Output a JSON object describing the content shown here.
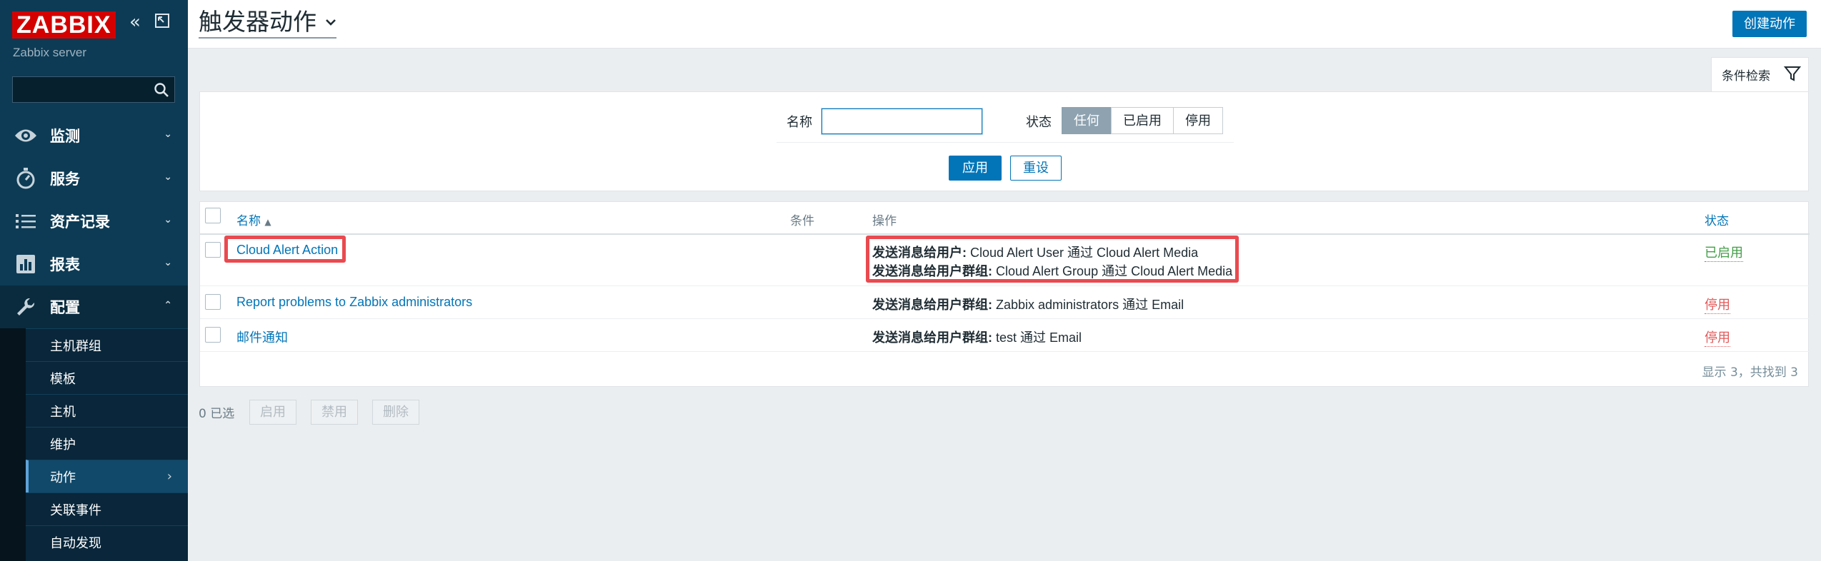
{
  "sidebar": {
    "logo": "ZABBIX",
    "server_name": "Zabbix server",
    "search_placeholder": "",
    "menu": [
      {
        "label": "监测",
        "icon": "eye-icon"
      },
      {
        "label": "服务",
        "icon": "stopwatch-icon"
      },
      {
        "label": "资产记录",
        "icon": "list-icon"
      },
      {
        "label": "报表",
        "icon": "report-chart-icon"
      },
      {
        "label": "配置",
        "icon": "wrench-icon"
      }
    ],
    "submenu": [
      {
        "label": "主机群组"
      },
      {
        "label": "模板"
      },
      {
        "label": "主机"
      },
      {
        "label": "维护"
      },
      {
        "label": "动作"
      },
      {
        "label": "关联事件"
      },
      {
        "label": "自动发现"
      }
    ]
  },
  "header": {
    "title": "触发器动作",
    "create_button": "创建动作"
  },
  "filter": {
    "tab_label": "条件检索",
    "name_label": "名称",
    "name_value": "",
    "status_label": "状态",
    "status_options": [
      "任何",
      "已启用",
      "停用"
    ],
    "status_selected": "任何",
    "apply": "应用",
    "reset": "重设"
  },
  "table": {
    "headers": {
      "name": "名称",
      "sort_indicator": "▲",
      "conditions": "条件",
      "operations": "操作",
      "status": "状态"
    },
    "rows": [
      {
        "name": "Cloud Alert Action",
        "conditions": "",
        "operations": [
          {
            "prefix": "发送消息给用户:",
            "text": " Cloud Alert User 通过 Cloud Alert Media"
          },
          {
            "prefix": "发送消息给用户群组:",
            "text": " Cloud Alert Group 通过 Cloud Alert Media"
          }
        ],
        "status": "已启用"
      },
      {
        "name": "Report problems to Zabbix administrators",
        "conditions": "",
        "operations": [
          {
            "prefix": "发送消息给用户群组:",
            "text": " Zabbix administrators 通过 Email"
          }
        ],
        "status": "停用"
      },
      {
        "name": "邮件通知",
        "conditions": "",
        "operations": [
          {
            "prefix": "发送消息给用户群组:",
            "text": " test 通过 Email"
          }
        ],
        "status": "停用"
      }
    ],
    "footer": "显示 3，共找到 3"
  },
  "mass_actions": {
    "selected_count": "0 已选",
    "enable": "启用",
    "disable": "禁用",
    "delete": "删除"
  },
  "colors": {
    "sidebar_bg": "#0d3b55",
    "accent": "#0275b8",
    "enabled": "#429e47",
    "disabled": "#e45959",
    "highlight_box": "#e94a50",
    "logo_red": "#d40000"
  }
}
